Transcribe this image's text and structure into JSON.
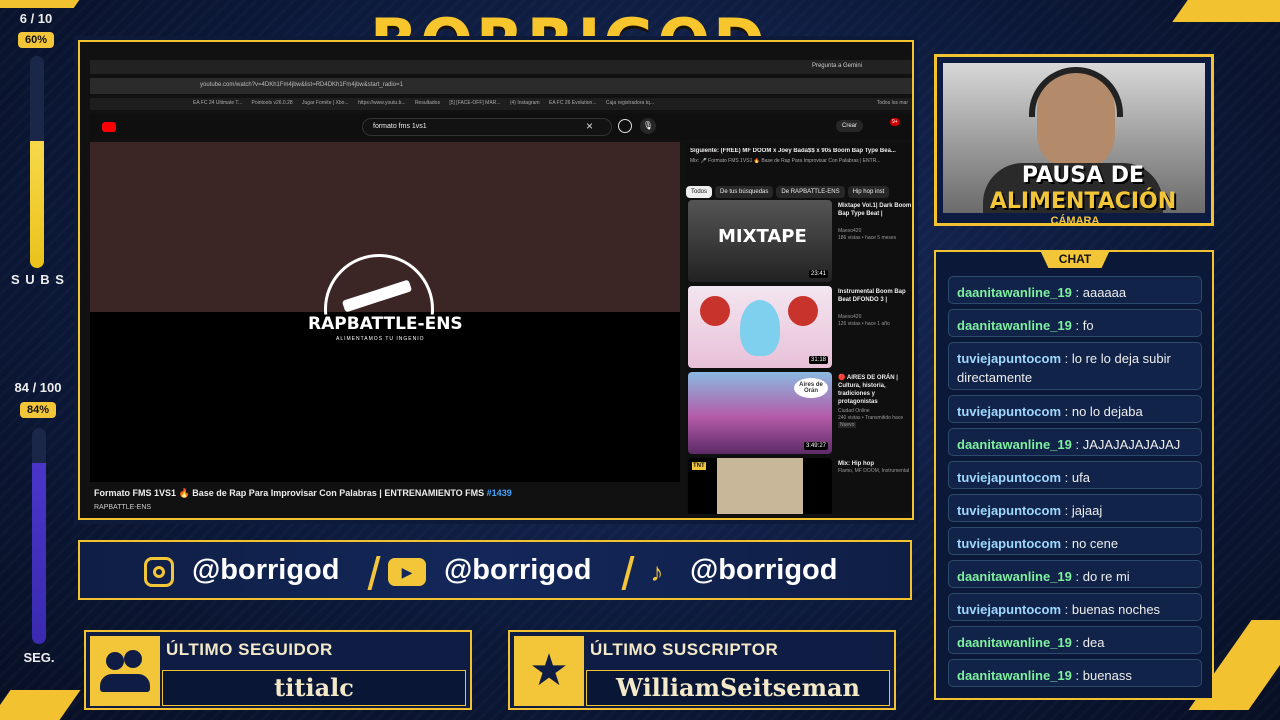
{
  "overlay": {
    "title": "BORRIGOD",
    "goal_top": {
      "count": "6 / 10",
      "percent": "60%",
      "label": "S U B S",
      "fill": 0.6
    },
    "goal_bottom": {
      "count": "84 / 100",
      "percent": "84%",
      "label": "SEG.",
      "fill": 0.84
    },
    "colors": {
      "accent": "#f2c230",
      "panel": "#0f1d44",
      "bg": "#0b1733"
    }
  },
  "browser": {
    "address": "youtube.com/watch?v=4DKh1Fm4jbw&list=RD4DKh1Fm4jbw&start_radio=1",
    "gemini": "Pregunta a Gemini",
    "bookmarks": [
      "EA FC 24 Ultimate T...",
      "Pointools v26.0.28",
      "Jugar Fornite | Xbo...",
      "https://www.youtu.b...",
      "Resultados",
      "[5] [FACE-OFF] MAR...",
      "(4) Instagram",
      "EA FC 26 Evolution...",
      "Caja registradora tq..."
    ],
    "all_bookmarks": "Todos los mar",
    "search_value": "formato fms 1vs1",
    "create_label": "Crear",
    "notif_count": "9+",
    "video_logo": "RAPBATTLE-ENS",
    "video_logo_sub": "ALIMENTAMOS TU INGENIO",
    "video_title": "Formato FMS 1VS1 🔥 Base de Rap Para Improvisar Con Palabras | ENTRENAMIENTO FMS",
    "video_tag": "#1439",
    "channel": "RAPBATTLE-ENS",
    "next_label": "Siguiente: (FREE) MF DOOM x Joey Bada$$ x 90s Boom Bap Type Bea...",
    "mix_label": "Mix: 🎤 Formato FMS 1VS1 🔥 Base de Rap Para Improvisar Con Palabras | ENTR...",
    "chips": [
      "Todos",
      "De tus búsquedas",
      "De RAPBATTLE-ENS",
      "Hip hop inst"
    ],
    "recs": [
      {
        "title": "Mixtape Vol.1| Dark Boom Bap Type Beat |",
        "channel": "Maexo420",
        "meta": "186 vistas • hace 5 meses",
        "duration": "23:41",
        "thumb_text": "MIXTAPE"
      },
      {
        "title": "Instrumental Boom Bap Beat DFONDO 3 |",
        "channel": "Maexo420",
        "meta": "126 vistas • hace 1 año",
        "duration": "31:18",
        "thumb_text": ""
      },
      {
        "title": "🔴 AIRES DE ORÁN | Cultura, historia, tradiciones y protagonistas",
        "channel": "Ciudad Online",
        "meta": "240 vistas • Transmitido hace",
        "duration": "3:49:27",
        "thumb_text": "Aires de Orán",
        "badge": "Nuevo"
      },
      {
        "title": "Mix: Hip hop",
        "channel": "",
        "meta": "Flamo, MF DOOM, Instrumental",
        "duration": "",
        "thumb_text": "TNT"
      }
    ]
  },
  "social": {
    "instagram": "@borrigod",
    "youtube": "@borrigod",
    "tiktok": "@borrigod"
  },
  "cards": {
    "follower_header": "ÚLTIMO SEGUIDOR",
    "follower_name": "titialc",
    "sub_header": "ÚLTIMO SUSCRIPTOR",
    "sub_name": "WilliamSeitseman"
  },
  "camera": {
    "line1": "PAUSA DE",
    "line2": "ALIMENTACIÓN",
    "label": "CÁMARA"
  },
  "chat": {
    "header": "CHAT",
    "messages": [
      {
        "user": "daanitawanline_19",
        "text": ": aaaaaa"
      },
      {
        "user": "daanitawanline_19",
        "text": ": fo"
      },
      {
        "user": "tuviejapuntocom",
        "text": ": lo re lo deja subir directamente"
      },
      {
        "user": "tuviejapuntocom",
        "text": ": no lo dejaba"
      },
      {
        "user": "daanitawanline_19",
        "text": ": JAJAJAJAJAJAJ"
      },
      {
        "user": "tuviejapuntocom",
        "text": ": ufa"
      },
      {
        "user": "tuviejapuntocom",
        "text": ": jajaaj"
      },
      {
        "user": "tuviejapuntocom",
        "text": ": no cene"
      },
      {
        "user": "daanitawanline_19",
        "text": ": do re mi"
      },
      {
        "user": "tuviejapuntocom",
        "text": ": buenas noches"
      },
      {
        "user": "daanitawanline_19",
        "text": ": dea"
      },
      {
        "user": "daanitawanline_19",
        "text": ": buenass"
      }
    ]
  }
}
